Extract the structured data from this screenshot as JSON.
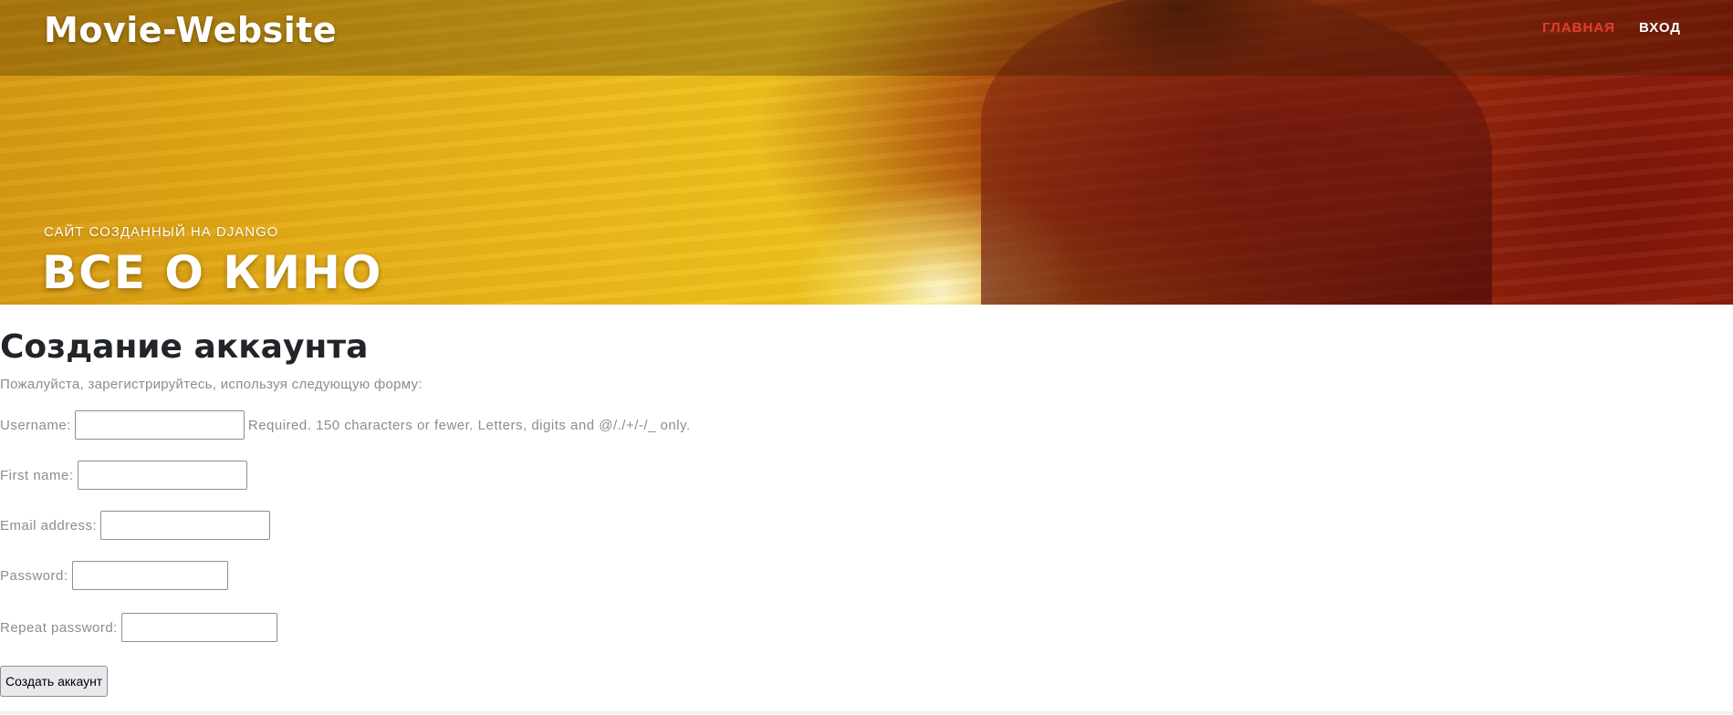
{
  "header": {
    "brand": "Movie-Website",
    "nav": [
      {
        "label": "ГЛАВНАЯ",
        "active": true
      },
      {
        "label": "ВХОД",
        "active": false
      }
    ],
    "subtitle": "САЙТ СОЗДАННЫЙ НА DJANGO",
    "title": "ВСЕ О КИНО"
  },
  "main": {
    "title": "Создание аккаунта",
    "description": "Пожалуйста, зарегистрируйтесь, используя следующую форму:",
    "fields": [
      {
        "label": "Username:",
        "value": "",
        "help": "Required. 150 characters or fewer. Letters, digits and @/./+/-/_ only."
      },
      {
        "label": "First name:",
        "value": ""
      },
      {
        "label": "Email address:",
        "value": ""
      },
      {
        "label": "Password:",
        "value": ""
      },
      {
        "label": "Repeat password:",
        "value": ""
      }
    ],
    "submit_label": "Создать аккаунт"
  },
  "colors": {
    "nav_active": "#e73c31",
    "muted_text": "#868e96",
    "heading_text": "#212529",
    "hero_gold": "#edbb1a",
    "hero_red": "#8d1a0a"
  }
}
